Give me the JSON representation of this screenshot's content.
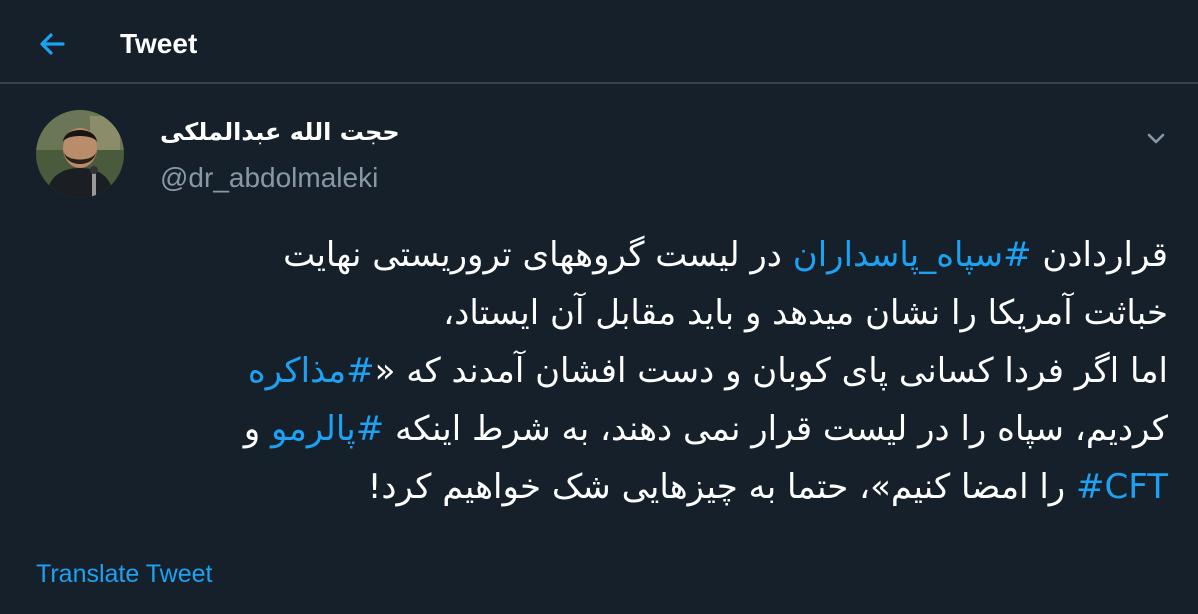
{
  "colors": {
    "background": "#15202b",
    "divider": "#38444d",
    "accent": "#1da1f2",
    "text_primary": "#ffffff",
    "text_secondary": "#8899a6"
  },
  "header": {
    "back_icon": "back-arrow-icon",
    "title": "Tweet"
  },
  "author": {
    "avatar_icon": "avatar",
    "display_name": "حجت الله عبدالملکی",
    "handle": "@dr_abdolmaleki",
    "menu_icon": "chevron-down-icon"
  },
  "tweet": {
    "line1": {
      "pre": "قراردادن ",
      "hashtag": "#سپاه_پاسداران",
      "post": " در لیست گروههای تروریستی نهایت"
    },
    "line2": "خباثت آمریکا را نشان میدهد و باید مقابل آن ایستاد،",
    "line3": {
      "pre": "اما اگر فردا کسانی پای کوبان و دست افشان آمدند که «",
      "hashtag": "#مذاکره"
    },
    "line4": {
      "pre": "کردیم، سپاه را در لیست قرار نمی دهند، به شرط اینکه ",
      "hashtag": "#پالرمو",
      "post": " و"
    },
    "line5": {
      "hashtag": "#CFT",
      "post": " را امضا کنیم»، حتما به چیزهایی شک خواهیم کرد!"
    }
  },
  "footer": {
    "translate_label": "Translate Tweet"
  }
}
